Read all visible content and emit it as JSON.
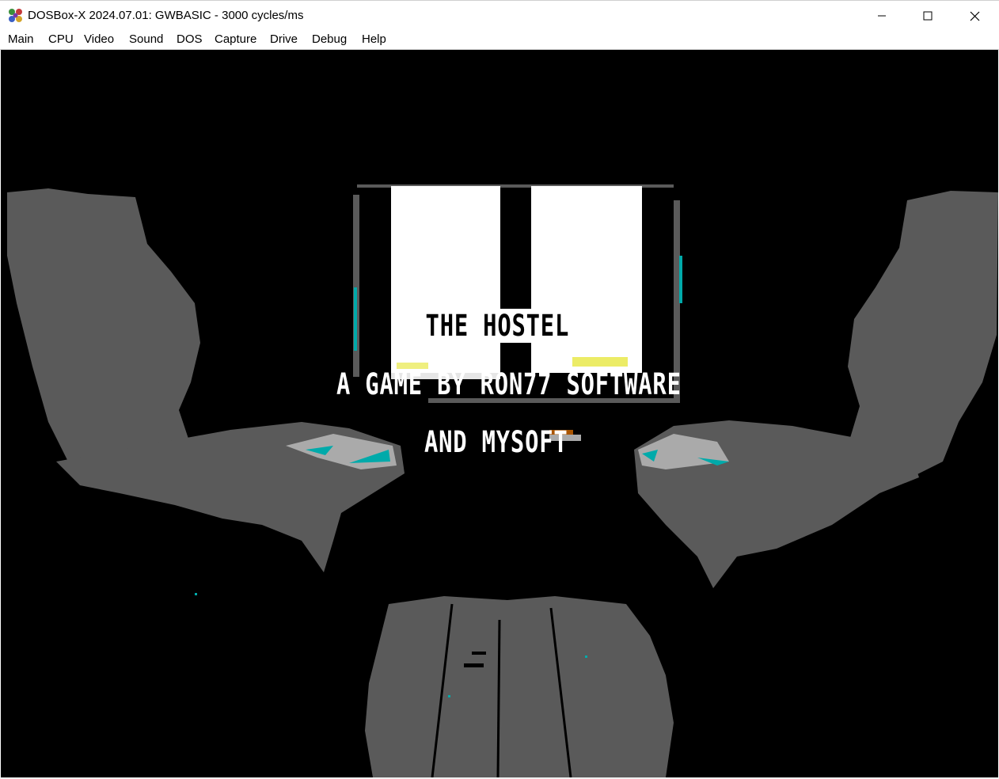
{
  "window": {
    "title": "DOSBox-X 2024.07.01: GWBASIC - 3000 cycles/ms",
    "controls": [
      "minimize",
      "maximize",
      "close"
    ]
  },
  "menu": {
    "items": [
      "Main",
      "CPU",
      "Video",
      "Sound",
      "DOS",
      "Capture",
      "Drive",
      "Debug",
      "Help"
    ]
  },
  "game": {
    "title_line": "THE HOSTEL",
    "byline": "A GAME BY RON77 SOFTWARE",
    "coauthor": "AND MYSOFT"
  },
  "colors": {
    "screen_bg": "#000000",
    "scene_gray": "#5a5a5a",
    "light_gray": "#aaaaaa",
    "cyan": "#00aaaa",
    "window_white": "#ffffff"
  }
}
